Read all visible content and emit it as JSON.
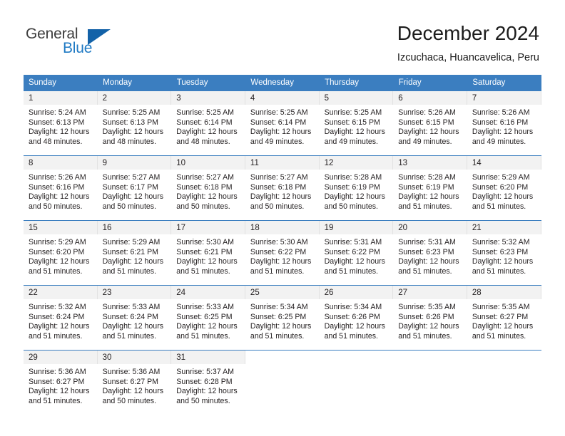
{
  "brand": {
    "name_part1": "General",
    "name_part2": "Blue",
    "triangle_color": "#1362a8",
    "blue_color": "#1f7ac4"
  },
  "header": {
    "title": "December 2024",
    "subtitle": "Izcuchaca, Huancavelica, Peru"
  },
  "theme": {
    "header_row_bg": "#3b7ec0",
    "daynum_bg": "#f2f2f2",
    "grid_line": "#3b7ec0"
  },
  "weekdays": [
    "Sunday",
    "Monday",
    "Tuesday",
    "Wednesday",
    "Thursday",
    "Friday",
    "Saturday"
  ],
  "weeks": [
    [
      {
        "day": "1",
        "sunrise": "Sunrise: 5:24 AM",
        "sunset": "Sunset: 6:13 PM",
        "daylight1": "Daylight: 12 hours",
        "daylight2": "and 48 minutes."
      },
      {
        "day": "2",
        "sunrise": "Sunrise: 5:25 AM",
        "sunset": "Sunset: 6:13 PM",
        "daylight1": "Daylight: 12 hours",
        "daylight2": "and 48 minutes."
      },
      {
        "day": "3",
        "sunrise": "Sunrise: 5:25 AM",
        "sunset": "Sunset: 6:14 PM",
        "daylight1": "Daylight: 12 hours",
        "daylight2": "and 48 minutes."
      },
      {
        "day": "4",
        "sunrise": "Sunrise: 5:25 AM",
        "sunset": "Sunset: 6:14 PM",
        "daylight1": "Daylight: 12 hours",
        "daylight2": "and 49 minutes."
      },
      {
        "day": "5",
        "sunrise": "Sunrise: 5:25 AM",
        "sunset": "Sunset: 6:15 PM",
        "daylight1": "Daylight: 12 hours",
        "daylight2": "and 49 minutes."
      },
      {
        "day": "6",
        "sunrise": "Sunrise: 5:26 AM",
        "sunset": "Sunset: 6:15 PM",
        "daylight1": "Daylight: 12 hours",
        "daylight2": "and 49 minutes."
      },
      {
        "day": "7",
        "sunrise": "Sunrise: 5:26 AM",
        "sunset": "Sunset: 6:16 PM",
        "daylight1": "Daylight: 12 hours",
        "daylight2": "and 49 minutes."
      }
    ],
    [
      {
        "day": "8",
        "sunrise": "Sunrise: 5:26 AM",
        "sunset": "Sunset: 6:16 PM",
        "daylight1": "Daylight: 12 hours",
        "daylight2": "and 50 minutes."
      },
      {
        "day": "9",
        "sunrise": "Sunrise: 5:27 AM",
        "sunset": "Sunset: 6:17 PM",
        "daylight1": "Daylight: 12 hours",
        "daylight2": "and 50 minutes."
      },
      {
        "day": "10",
        "sunrise": "Sunrise: 5:27 AM",
        "sunset": "Sunset: 6:18 PM",
        "daylight1": "Daylight: 12 hours",
        "daylight2": "and 50 minutes."
      },
      {
        "day": "11",
        "sunrise": "Sunrise: 5:27 AM",
        "sunset": "Sunset: 6:18 PM",
        "daylight1": "Daylight: 12 hours",
        "daylight2": "and 50 minutes."
      },
      {
        "day": "12",
        "sunrise": "Sunrise: 5:28 AM",
        "sunset": "Sunset: 6:19 PM",
        "daylight1": "Daylight: 12 hours",
        "daylight2": "and 50 minutes."
      },
      {
        "day": "13",
        "sunrise": "Sunrise: 5:28 AM",
        "sunset": "Sunset: 6:19 PM",
        "daylight1": "Daylight: 12 hours",
        "daylight2": "and 51 minutes."
      },
      {
        "day": "14",
        "sunrise": "Sunrise: 5:29 AM",
        "sunset": "Sunset: 6:20 PM",
        "daylight1": "Daylight: 12 hours",
        "daylight2": "and 51 minutes."
      }
    ],
    [
      {
        "day": "15",
        "sunrise": "Sunrise: 5:29 AM",
        "sunset": "Sunset: 6:20 PM",
        "daylight1": "Daylight: 12 hours",
        "daylight2": "and 51 minutes."
      },
      {
        "day": "16",
        "sunrise": "Sunrise: 5:29 AM",
        "sunset": "Sunset: 6:21 PM",
        "daylight1": "Daylight: 12 hours",
        "daylight2": "and 51 minutes."
      },
      {
        "day": "17",
        "sunrise": "Sunrise: 5:30 AM",
        "sunset": "Sunset: 6:21 PM",
        "daylight1": "Daylight: 12 hours",
        "daylight2": "and 51 minutes."
      },
      {
        "day": "18",
        "sunrise": "Sunrise: 5:30 AM",
        "sunset": "Sunset: 6:22 PM",
        "daylight1": "Daylight: 12 hours",
        "daylight2": "and 51 minutes."
      },
      {
        "day": "19",
        "sunrise": "Sunrise: 5:31 AM",
        "sunset": "Sunset: 6:22 PM",
        "daylight1": "Daylight: 12 hours",
        "daylight2": "and 51 minutes."
      },
      {
        "day": "20",
        "sunrise": "Sunrise: 5:31 AM",
        "sunset": "Sunset: 6:23 PM",
        "daylight1": "Daylight: 12 hours",
        "daylight2": "and 51 minutes."
      },
      {
        "day": "21",
        "sunrise": "Sunrise: 5:32 AM",
        "sunset": "Sunset: 6:23 PM",
        "daylight1": "Daylight: 12 hours",
        "daylight2": "and 51 minutes."
      }
    ],
    [
      {
        "day": "22",
        "sunrise": "Sunrise: 5:32 AM",
        "sunset": "Sunset: 6:24 PM",
        "daylight1": "Daylight: 12 hours",
        "daylight2": "and 51 minutes."
      },
      {
        "day": "23",
        "sunrise": "Sunrise: 5:33 AM",
        "sunset": "Sunset: 6:24 PM",
        "daylight1": "Daylight: 12 hours",
        "daylight2": "and 51 minutes."
      },
      {
        "day": "24",
        "sunrise": "Sunrise: 5:33 AM",
        "sunset": "Sunset: 6:25 PM",
        "daylight1": "Daylight: 12 hours",
        "daylight2": "and 51 minutes."
      },
      {
        "day": "25",
        "sunrise": "Sunrise: 5:34 AM",
        "sunset": "Sunset: 6:25 PM",
        "daylight1": "Daylight: 12 hours",
        "daylight2": "and 51 minutes."
      },
      {
        "day": "26",
        "sunrise": "Sunrise: 5:34 AM",
        "sunset": "Sunset: 6:26 PM",
        "daylight1": "Daylight: 12 hours",
        "daylight2": "and 51 minutes."
      },
      {
        "day": "27",
        "sunrise": "Sunrise: 5:35 AM",
        "sunset": "Sunset: 6:26 PM",
        "daylight1": "Daylight: 12 hours",
        "daylight2": "and 51 minutes."
      },
      {
        "day": "28",
        "sunrise": "Sunrise: 5:35 AM",
        "sunset": "Sunset: 6:27 PM",
        "daylight1": "Daylight: 12 hours",
        "daylight2": "and 51 minutes."
      }
    ],
    [
      {
        "day": "29",
        "sunrise": "Sunrise: 5:36 AM",
        "sunset": "Sunset: 6:27 PM",
        "daylight1": "Daylight: 12 hours",
        "daylight2": "and 51 minutes."
      },
      {
        "day": "30",
        "sunrise": "Sunrise: 5:36 AM",
        "sunset": "Sunset: 6:27 PM",
        "daylight1": "Daylight: 12 hours",
        "daylight2": "and 50 minutes."
      },
      {
        "day": "31",
        "sunrise": "Sunrise: 5:37 AM",
        "sunset": "Sunset: 6:28 PM",
        "daylight1": "Daylight: 12 hours",
        "daylight2": "and 50 minutes."
      },
      {
        "day": "",
        "sunrise": "",
        "sunset": "",
        "daylight1": "",
        "daylight2": ""
      },
      {
        "day": "",
        "sunrise": "",
        "sunset": "",
        "daylight1": "",
        "daylight2": ""
      },
      {
        "day": "",
        "sunrise": "",
        "sunset": "",
        "daylight1": "",
        "daylight2": ""
      },
      {
        "day": "",
        "sunrise": "",
        "sunset": "",
        "daylight1": "",
        "daylight2": ""
      }
    ]
  ]
}
